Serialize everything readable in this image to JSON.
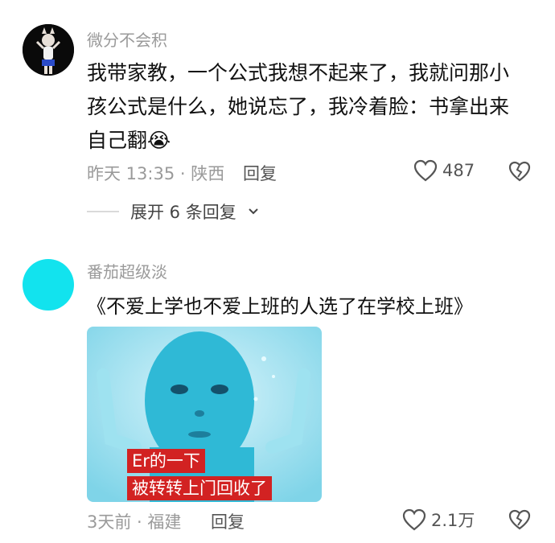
{
  "comments": [
    {
      "username": "微分不会积",
      "text": "我带家教，一个公式我想不起来了，我就问那小孩公式是什么，她说忘了，我冷着脸：书拿出来自己翻",
      "emoji": "😭",
      "meta": "昨天 13:35 · 陕西",
      "reply_label": "回复",
      "likes": "487",
      "expand_label": "展开 6 条回复"
    },
    {
      "username": "番茄超级淡",
      "text": "《不爱上学也不爱上班的人选了在学校上班》",
      "image_caption_1": "Er的一下",
      "image_caption_2": "被转转上门回收了",
      "meta": "3天前 · 福建",
      "reply_label": "回复",
      "likes": "2.1万"
    }
  ],
  "colors": {
    "avatar2": "#12e3ee",
    "caption_bg": "#d22222",
    "meta_gray": "#9a9a9a"
  },
  "icons": [
    "heart-outline-icon",
    "broken-heart-icon",
    "chevron-down-icon"
  ]
}
